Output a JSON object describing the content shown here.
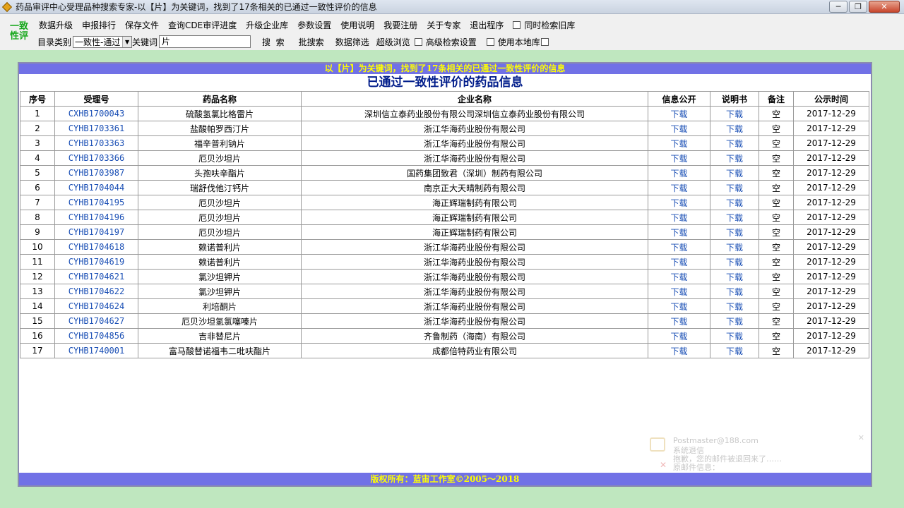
{
  "window": {
    "title": "药品审评中心受理品种搜索专家-以【片】为关键词，找到了17条相关的已通过一致性评价的信息",
    "btn_min": "─",
    "btn_max": "❐",
    "btn_close": "✕"
  },
  "logo": {
    "line1": "一致",
    "line2": "性评"
  },
  "menu": [
    "数据升级",
    "申报排行",
    "保存文件",
    "查询CDE审评进度",
    "升级企业库",
    "参数设置",
    "使用说明",
    "我要注册",
    "关于专家",
    "退出程序"
  ],
  "menu_checkbox": "同时检索旧库",
  "row2": {
    "catalog_label": "目录类别",
    "catalog_value": "一致性-通过",
    "keyword_label": "关键词",
    "keyword_value": "片",
    "search": "搜  索",
    "batch_search": "批搜索",
    "data_filter": "数据筛选",
    "super_browse": "超级浏览",
    "advanced": "高级检索设置",
    "local_lib": "使用本地库"
  },
  "result": {
    "banner": "以【片】为关键词，找到了17条相关的已通过一致性评价的信息",
    "title": "已通过一致性评价的药品信息",
    "columns": [
      "序号",
      "受理号",
      "药品名称",
      "企业名称",
      "信息公开",
      "说明书",
      "备注",
      "公示时间"
    ],
    "rows": [
      [
        "1",
        "CXHB1700043",
        "硫酸氢氯比格雷片",
        "深圳信立泰药业股份有限公司深圳信立泰药业股份有限公司",
        "下载",
        "下载",
        "空",
        "2017-12-29"
      ],
      [
        "2",
        "CYHB1703361",
        "盐酸帕罗西汀片",
        "浙江华海药业股份有限公司",
        "下载",
        "下载",
        "空",
        "2017-12-29"
      ],
      [
        "3",
        "CYHB1703363",
        "福辛普利钠片",
        "浙江华海药业股份有限公司",
        "下载",
        "下载",
        "空",
        "2017-12-29"
      ],
      [
        "4",
        "CYHB1703366",
        "厄贝沙坦片",
        "浙江华海药业股份有限公司",
        "下载",
        "下载",
        "空",
        "2017-12-29"
      ],
      [
        "5",
        "CYHB1703987",
        "头孢呋辛酯片",
        "国药集团致君（深圳）制药有限公司",
        "下载",
        "下载",
        "空",
        "2017-12-29"
      ],
      [
        "6",
        "CYHB1704044",
        "瑞舒伐他汀钙片",
        "南京正大天晴制药有限公司",
        "下载",
        "下载",
        "空",
        "2017-12-29"
      ],
      [
        "7",
        "CYHB1704195",
        "厄贝沙坦片",
        "海正辉瑞制药有限公司",
        "下载",
        "下载",
        "空",
        "2017-12-29"
      ],
      [
        "8",
        "CYHB1704196",
        "厄贝沙坦片",
        "海正辉瑞制药有限公司",
        "下载",
        "下载",
        "空",
        "2017-12-29"
      ],
      [
        "9",
        "CYHB1704197",
        "厄贝沙坦片",
        "海正辉瑞制药有限公司",
        "下载",
        "下载",
        "空",
        "2017-12-29"
      ],
      [
        "10",
        "CYHB1704618",
        "赖诺普利片",
        "浙江华海药业股份有限公司",
        "下载",
        "下载",
        "空",
        "2017-12-29"
      ],
      [
        "11",
        "CYHB1704619",
        "赖诺普利片",
        "浙江华海药业股份有限公司",
        "下载",
        "下载",
        "空",
        "2017-12-29"
      ],
      [
        "12",
        "CYHB1704621",
        "氯沙坦钾片",
        "浙江华海药业股份有限公司",
        "下载",
        "下载",
        "空",
        "2017-12-29"
      ],
      [
        "13",
        "CYHB1704622",
        "氯沙坦钾片",
        "浙江华海药业股份有限公司",
        "下载",
        "下载",
        "空",
        "2017-12-29"
      ],
      [
        "14",
        "CYHB1704624",
        "利培酮片",
        "浙江华海药业股份有限公司",
        "下载",
        "下载",
        "空",
        "2017-12-29"
      ],
      [
        "15",
        "CYHB1704627",
        "厄贝沙坦氢氯噻嗪片",
        "浙江华海药业股份有限公司",
        "下载",
        "下载",
        "空",
        "2017-12-29"
      ],
      [
        "16",
        "CYHB1704856",
        "吉非替尼片",
        "齐鲁制药（海南）有限公司",
        "下载",
        "下载",
        "空",
        "2017-12-29"
      ],
      [
        "17",
        "CYHB1740001",
        "富马酸替诺福韦二吡呋酯片",
        "成都倍特药业有限公司",
        "下载",
        "下载",
        "空",
        "2017-12-29"
      ]
    ],
    "footer": "版权所有：蓝宙工作室©2005～2018"
  },
  "notification": {
    "sender": "Postmaster@188.com",
    "subject": "系统退信",
    "line1": "抱歉，您的邮件被退回来了……",
    "line2": "原邮件信息："
  },
  "colors": {
    "banner_bg": "#7171e6",
    "banner_text": "#ffff00",
    "main_bg": "#bfe7bf",
    "link": "#1a4fb5",
    "logo": "#19a81e"
  }
}
